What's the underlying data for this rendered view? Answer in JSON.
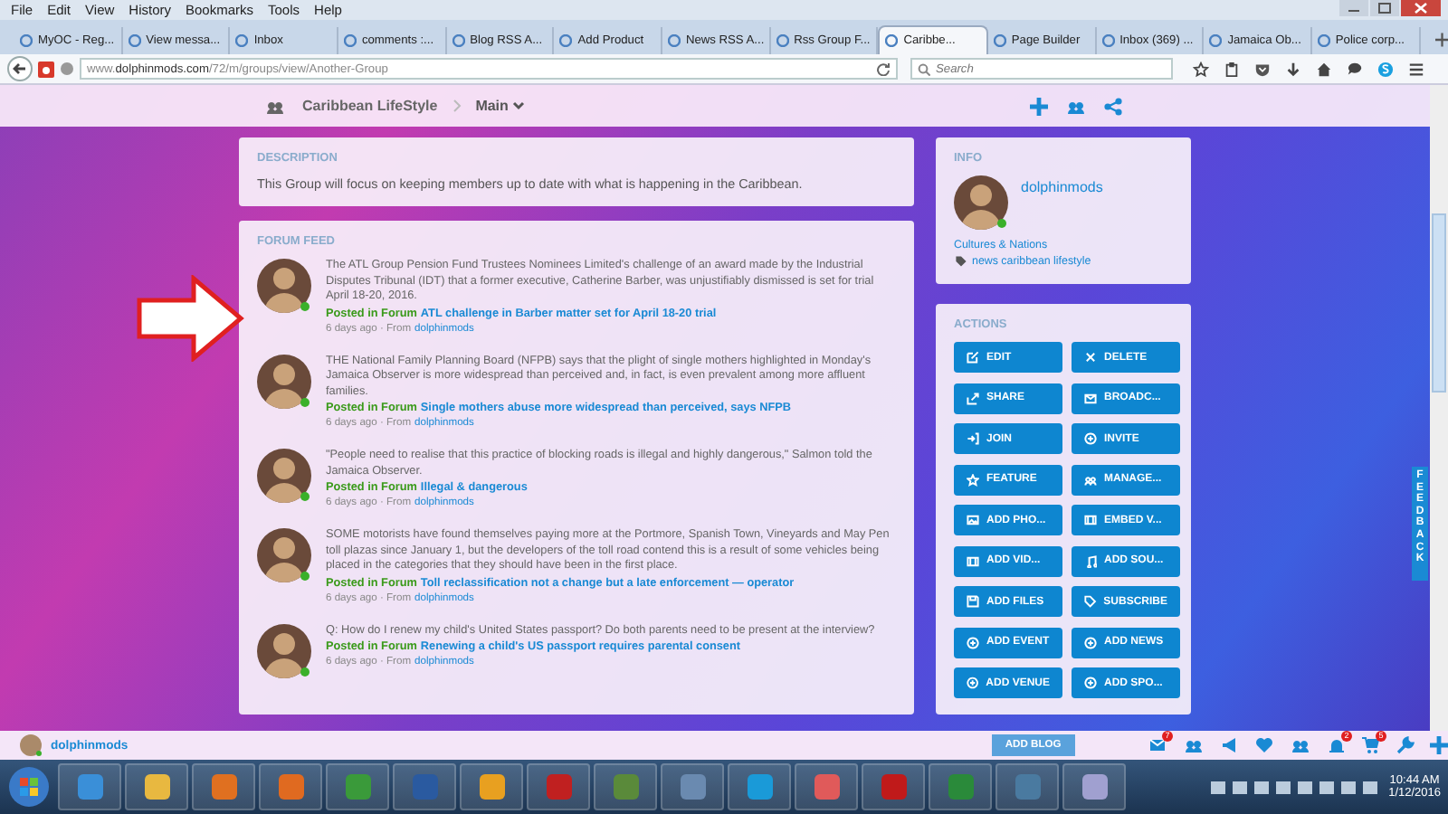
{
  "menu": [
    "File",
    "Edit",
    "View",
    "History",
    "Bookmarks",
    "Tools",
    "Help"
  ],
  "tabs": [
    {
      "label": "MyOC - Reg...",
      "selected": false
    },
    {
      "label": "View messa...",
      "selected": false
    },
    {
      "label": "Inbox",
      "selected": false
    },
    {
      "label": "comments :...",
      "selected": false
    },
    {
      "label": "Blog RSS A...",
      "selected": false
    },
    {
      "label": "Add Product",
      "selected": false
    },
    {
      "label": "News RSS A...",
      "selected": false
    },
    {
      "label": "Rss Group F...",
      "selected": false
    },
    {
      "label": "Caribbe...",
      "selected": true
    },
    {
      "label": "Page Builder",
      "selected": false
    },
    {
      "label": "Inbox (369) ...",
      "selected": false
    },
    {
      "label": "Jamaica Ob...",
      "selected": false
    },
    {
      "label": "Police corp...",
      "selected": false
    }
  ],
  "address": {
    "url": "www.**dolphinmods.com**/72/m/groups/view/Another-Group"
  },
  "search": {
    "placeholder": "Search"
  },
  "group_header": {
    "title": "Caribbean LifeStyle",
    "section": "Main"
  },
  "description": {
    "heading": "DESCRIPTION",
    "text": "This Group will focus on keeping members up to date with what is happening in the Caribbean."
  },
  "forum_feed": {
    "heading": "FORUM FEED",
    "posts": [
      {
        "text": "The ATL Group Pension Fund Trustees Nominees Limited's challenge of an award made by the Industrial Disputes Tribunal (IDT) that a former executive, Catherine Barber, was unjustifiably dismissed is set for trial April 18-20, 2016.",
        "posted_in": "Posted in Forum",
        "title": "ATL challenge in Barber matter set for April 18-20 trial",
        "time": "6 days ago · From",
        "author": "dolphinmods",
        "online": true
      },
      {
        "text": "THE National Family Planning Board (NFPB) says that the plight of single mothers highlighted in Monday's Jamaica Observer is more widespread than perceived and, in fact, is even prevalent among more affluent families.",
        "posted_in": "Posted in Forum",
        "title": "Single mothers abuse more widespread than perceived, says NFPB",
        "time": "6 days ago · From",
        "author": "dolphinmods",
        "online": true
      },
      {
        "text": "\"People need to realise that this practice of blocking roads is illegal and highly dangerous,\" Salmon told the Jamaica Observer.",
        "posted_in": "Posted in Forum",
        "title": "Illegal & dangerous",
        "time": "6 days ago · From",
        "author": "dolphinmods",
        "online": true
      },
      {
        "text": "SOME motorists have found themselves paying more at the Portmore, Spanish Town, Vineyards and May Pen toll plazas since January 1, but the developers of the toll road contend this is a result of some vehicles being placed in the categories that they should have been in the first place.",
        "posted_in": "Posted in Forum",
        "title": "Toll reclassification not a change but a late enforcement — operator",
        "time": "6 days ago · From",
        "author": "dolphinmods",
        "online": true
      },
      {
        "text": "Q: How do I renew my child's United States passport? Do both parents need to be present at the interview?",
        "posted_in": "Posted in Forum",
        "title": "Renewing a child's US passport requires parental consent",
        "time": "6 days ago · From",
        "author": "dolphinmods",
        "online": true
      }
    ]
  },
  "info": {
    "heading": "INFO",
    "user": "dolphinmods",
    "online": true,
    "category": "Cultures & Nations",
    "tags": "news caribbean lifestyle"
  },
  "actions": {
    "heading": "ACTIONS",
    "buttons": [
      "EDIT",
      "DELETE",
      "SHARE",
      "BROADC...",
      "JOIN",
      "INVITE",
      "FEATURE",
      "MANAGE...",
      "ADD PHO...",
      "EMBED V...",
      "ADD VID...",
      "ADD SOU...",
      "ADD FILES",
      "SUBSCRIBE",
      "ADD EVENT",
      "ADD NEWS",
      "ADD VENUE",
      "ADD SPO..."
    ]
  },
  "feedback_tab": "FEEDBACK",
  "bottom_bar": {
    "user": "dolphinmods",
    "online": true,
    "partial_button": "ADD BLOG",
    "mail_badge": "7",
    "bell_badge": "2",
    "cart_badge": "5"
  },
  "taskbar": {
    "time": "10:44 AM",
    "date": "1/12/2016"
  }
}
